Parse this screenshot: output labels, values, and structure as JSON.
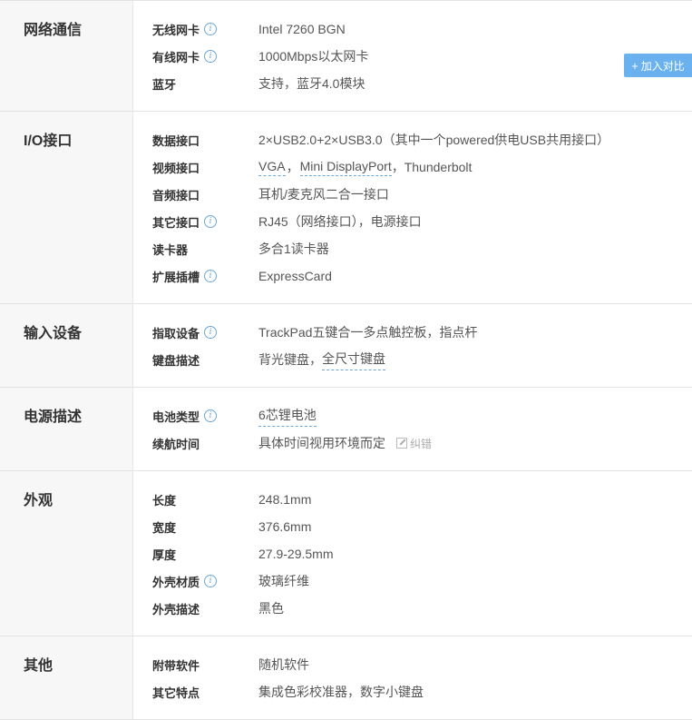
{
  "compare_button": {
    "icon": "+",
    "label": "加入对比"
  },
  "edit_link": {
    "label": "纠错"
  },
  "sections": {
    "network": {
      "title": "网络通信",
      "rows": [
        {
          "label": "无线网卡",
          "value": "Intel 7260 BGN"
        },
        {
          "label": "有线网卡",
          "value": "1000Mbps以太网卡"
        },
        {
          "label": "蓝牙",
          "value": "支持，蓝牙4.0模块"
        }
      ]
    },
    "io": {
      "title": "I/O接口",
      "rows": [
        {
          "label": "数据接口",
          "value": "2×USB2.0+2×USB3.0（其中一个powered供电USB共用接口）"
        },
        {
          "label": "视频接口",
          "parts": [
            "VGA",
            "，",
            "Mini DisplayPort",
            "，Thunderbolt"
          ]
        },
        {
          "label": "音频接口",
          "value": "耳机/麦克风二合一接口"
        },
        {
          "label": "其它接口",
          "value": "RJ45（网络接口），电源接口"
        },
        {
          "label": "读卡器",
          "value": "多合1读卡器"
        },
        {
          "label": "扩展插槽",
          "value": "ExpressCard"
        }
      ]
    },
    "input": {
      "title": "输入设备",
      "rows": [
        {
          "label": "指取设备",
          "value": "TrackPad五键合一多点触控板，指点杆"
        },
        {
          "label": "键盘描述",
          "parts": [
            "背光键盘，",
            "全尺寸键盘"
          ]
        }
      ]
    },
    "power": {
      "title": "电源描述",
      "rows": [
        {
          "label": "电池类型",
          "value": "6芯锂电池"
        },
        {
          "label": "续航时间",
          "value": "具体时间视用环境而定"
        }
      ]
    },
    "appearance": {
      "title": "外观",
      "rows": [
        {
          "label": "长度",
          "value": "248.1mm"
        },
        {
          "label": "宽度",
          "value": "376.6mm"
        },
        {
          "label": "厚度",
          "value": "27.9-29.5mm"
        },
        {
          "label": "外壳材质",
          "value": "玻璃纤维"
        },
        {
          "label": "外壳描述",
          "value": "黑色"
        }
      ]
    },
    "other": {
      "title": "其他",
      "rows": [
        {
          "label": "附带软件",
          "value": "随机软件"
        },
        {
          "label": "其它特点",
          "value": "集成色彩校准器，数字小键盘"
        }
      ]
    }
  }
}
